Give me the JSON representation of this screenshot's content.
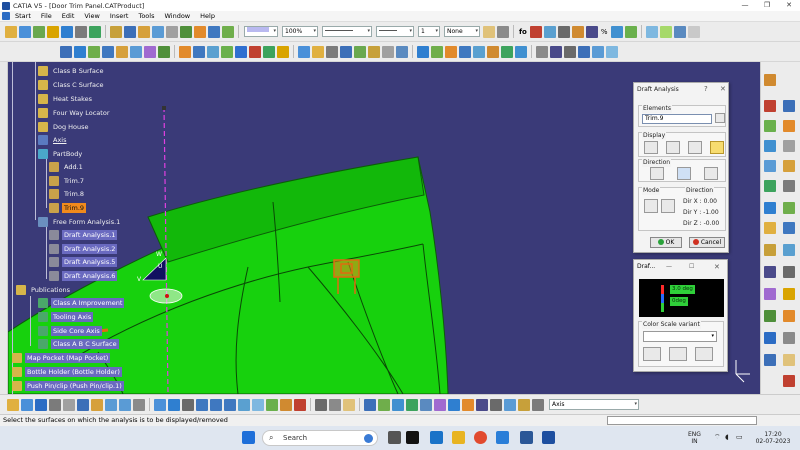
{
  "window": {
    "title": "CATIA V5 - [Door Trim Panel.CATProduct]"
  },
  "menu": [
    "Start",
    "File",
    "Edit",
    "View",
    "Insert",
    "Tools",
    "Window",
    "Help"
  ],
  "toolbar": {
    "zoom_value": "100%",
    "line_value": "1",
    "none_value": "None",
    "fog_label": "fo",
    "percent_label": "%"
  },
  "tree": {
    "items": [
      {
        "label": "Class B Surface"
      },
      {
        "label": "Class C Surface"
      },
      {
        "label": "Heat Stakes"
      },
      {
        "label": "Four Way Locator"
      },
      {
        "label": "Dog House"
      },
      {
        "label": "Axis"
      },
      {
        "label": "PartBody"
      },
      {
        "label": "Add.1"
      },
      {
        "label": "Trim.7"
      },
      {
        "label": "Trim.8"
      },
      {
        "label": "Trim.9"
      },
      {
        "label": "Free Form Analysis.1"
      },
      {
        "label": "Draft Analysis.1"
      },
      {
        "label": "Draft Analysis.2"
      },
      {
        "label": "Draft Analysis.5"
      },
      {
        "label": "Draft Analysis.6"
      },
      {
        "label": "Publications"
      },
      {
        "label": "Class A Improvement"
      },
      {
        "label": "Tooling Axis"
      },
      {
        "label": "Side Core Axis"
      },
      {
        "label": "Class A B C Surface"
      },
      {
        "label": "Map Pocket (Map Pocket)"
      },
      {
        "label": "Bottle Holder (Bottle Holder)"
      },
      {
        "label": "Push Pin/clip (Push Pin/clip.1)"
      }
    ]
  },
  "compass": {
    "label_w": "W",
    "label_u": "U",
    "label_v": "V"
  },
  "draft_dialog": {
    "title": "Draft Analysis",
    "help": "?",
    "close": "✕",
    "elements_label": "Elements",
    "elements_value": "Trim.9",
    "display_label": "Display",
    "direction_label": "Direction",
    "mode_label": "Mode",
    "direction_box_label": "Direction",
    "dir_x": "Dir X :  0.00",
    "dir_y": "Dir Y :  -1.00",
    "dir_z": "Dir Z :  -0.00",
    "ok": "OK",
    "cancel": "Cancel"
  },
  "scale_dialog": {
    "title": "Draf...",
    "minimize": "—",
    "maximize": "☐",
    "close": "✕",
    "value_top": "3.0 deg",
    "value_bottom": "0deg",
    "variant_label": "Color Scale variant"
  },
  "bottom_toolbar": {
    "axis_value": "Axis"
  },
  "status": {
    "message": "Select the surfaces on which the analysis is to be displayed/removed"
  },
  "taskbar": {
    "search_placeholder": "Search",
    "lang": "ENG",
    "region": "IN",
    "time": "17:20",
    "date": "02-07-2023"
  },
  "colors": {
    "background": "#3a3a78",
    "part": "#17d10d",
    "selection": "#f08a1c",
    "tree_highlight": "#6a6ac0"
  }
}
